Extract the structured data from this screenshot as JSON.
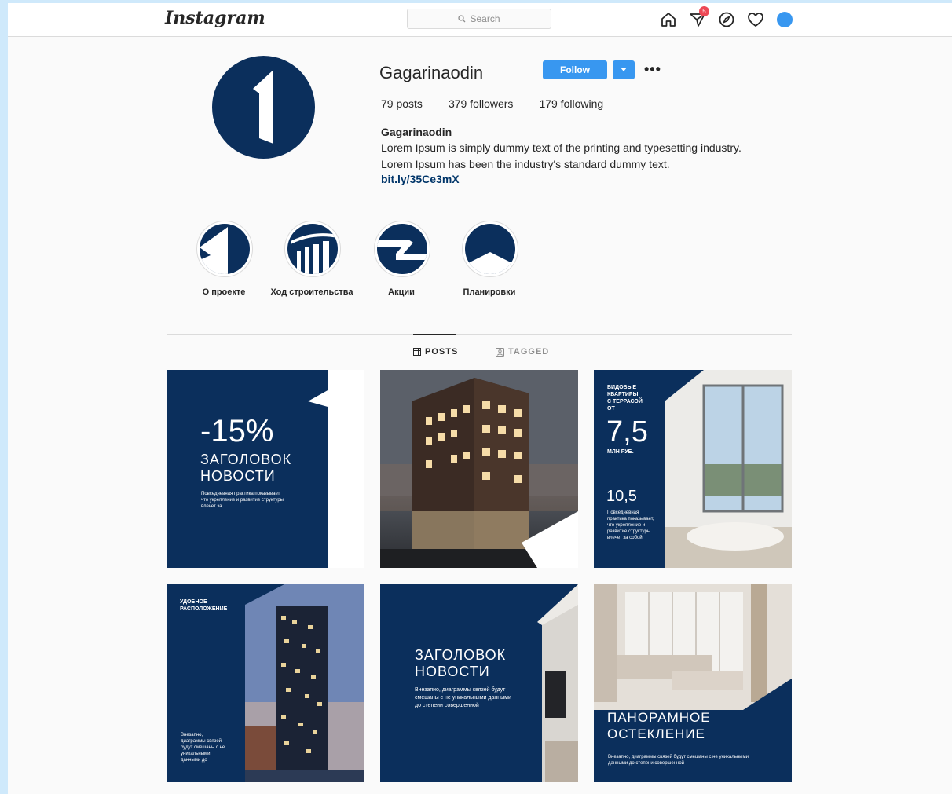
{
  "topbar": {
    "logo": "Instagram",
    "search_placeholder": "Search",
    "notifications_count": "5",
    "icons": [
      "home-icon",
      "direct-icon",
      "explore-icon",
      "heart-icon",
      "profile-avatar"
    ]
  },
  "profile": {
    "username": "Gagarinaodin",
    "follow_label": "Follow",
    "stats": {
      "posts": "79 posts",
      "followers": "379 followers",
      "following": "179 following"
    },
    "bio_name": "Gagarinaodin",
    "bio_text": "Lorem Ipsum is simply dummy text of the printing and typesetting industry. Lorem Ipsum has been the industry's standard dummy text.",
    "bio_link": "bit.ly/35Ce3mX"
  },
  "highlights": [
    {
      "label": "О проекте"
    },
    {
      "label": "Ход строительства"
    },
    {
      "label": "Акции"
    },
    {
      "label": "Планировки"
    }
  ],
  "tabs": {
    "posts": "POSTS",
    "tagged": "TAGGED"
  },
  "posts": {
    "p1": {
      "big": "-15%",
      "title1": "ЗАГОЛОВОК",
      "title2": "НОВОСТИ",
      "small": "Повседневная практика показывает, что укрепление и развитие структуры влечет за"
    },
    "p3": {
      "top1": "ВИДОВЫЕ",
      "top2": "КВАРТИРЫ",
      "top3": "С ТЕРРАСОЙ",
      "top4": "ОТ",
      "big": "7,5",
      "unit": "МЛН РУБ.",
      "big2": "10,5",
      "small": "Повседневная практика показывает, что укрепление и развитие структуры влечет за собой"
    },
    "p4": {
      "top1": "УДОБНОЕ",
      "top2": "РАСПОЛОЖЕНИЕ",
      "small": "Внезапно, диаграммы связей будут смешаны с не уникальными данными до"
    },
    "p5": {
      "title1": "ЗАГОЛОВОК",
      "title2": "НОВОСТИ",
      "small": "Внезапно, диаграммы связей будут смешаны с не уникальными данными до степени совершенной"
    },
    "p6": {
      "title1": "ПАНОРАМНОЕ",
      "title2": "ОСТЕКЛЕНИЕ",
      "small": "Внезапно, диаграммы связей будут смешаны с не уникальными данными до степени совершенной"
    }
  },
  "colors": {
    "brand_navy": "#0b2f5c",
    "follow_blue": "#3897f0",
    "page_bg": "#fafafa",
    "frame_bg": "#cfe9fb"
  }
}
